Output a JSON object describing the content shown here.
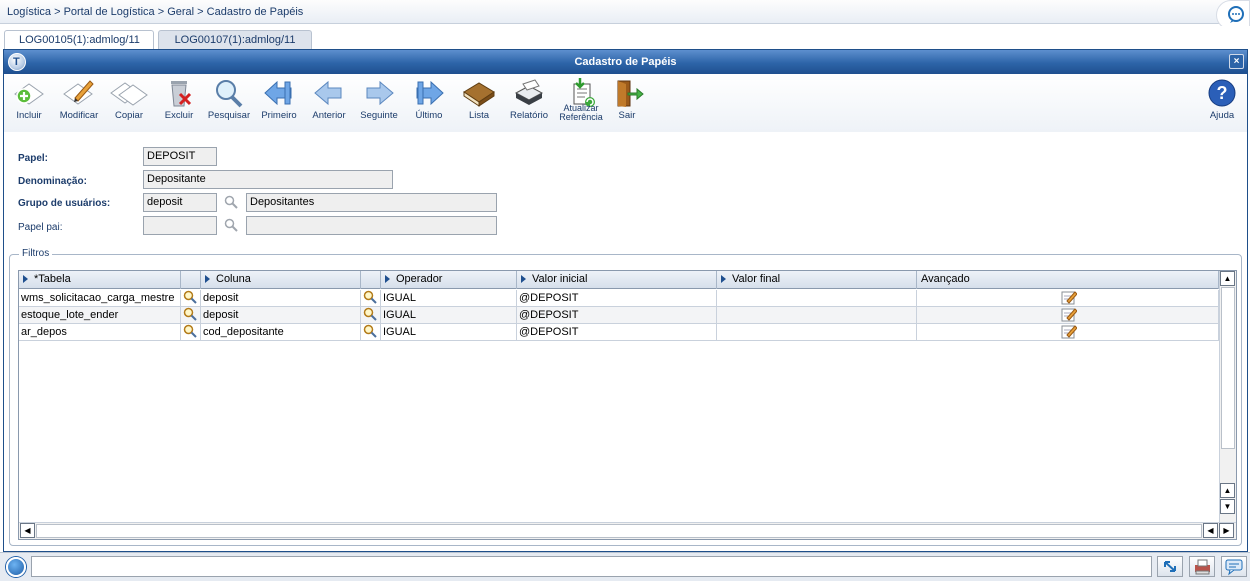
{
  "breadcrumb": "Logística > Portal de Logística > Geral > Cadastro de Papéis",
  "tabs": [
    {
      "label": "LOG00105(1):admlog/11",
      "active": true
    },
    {
      "label": "LOG00107(1):admlog/11",
      "active": false
    }
  ],
  "window": {
    "title": "Cadastro de Papéis",
    "logo_letter": "T",
    "close_label": "×"
  },
  "toolbar": {
    "incluir": "Incluir",
    "modificar": "Modificar",
    "copiar": "Copiar",
    "excluir": "Excluir",
    "pesquisar": "Pesquisar",
    "primeiro": "Primeiro",
    "anterior": "Anterior",
    "seguinte": "Seguinte",
    "ultimo": "Último",
    "lista": "Lista",
    "relatorio": "Relatório",
    "atualizar_1": "Atualizar",
    "atualizar_2": "Referência",
    "sair": "Sair",
    "ajuda": "Ajuda"
  },
  "form": {
    "papel_label": "Papel:",
    "papel_value": "DEPOSIT",
    "denominacao_label": "Denominação:",
    "denominacao_value": "Depositante",
    "grupo_label": "Grupo de usuários:",
    "grupo_code": "deposit",
    "grupo_desc": "Depositantes",
    "papel_pai_label": "Papel pai:",
    "papel_pai_code": "",
    "papel_pai_desc": ""
  },
  "filtros": {
    "legend": "Filtros",
    "columns": {
      "tabela": "*Tabela",
      "coluna": "Coluna",
      "operador": "Operador",
      "valor_inicial": "Valor inicial",
      "valor_final": "Valor final",
      "avancado": "Avançado"
    },
    "rows": [
      {
        "tabela": "wms_solicitacao_carga_mestre",
        "coluna": "deposit",
        "operador": "IGUAL",
        "valor_inicial": "@DEPOSIT",
        "valor_final": ""
      },
      {
        "tabela": "estoque_lote_ender",
        "coluna": "deposit",
        "operador": "IGUAL",
        "valor_inicial": "@DEPOSIT",
        "valor_final": ""
      },
      {
        "tabela": "ar_depos",
        "coluna": "cod_depositante",
        "operador": "IGUAL",
        "valor_inicial": "@DEPOSIT",
        "valor_final": ""
      }
    ]
  },
  "colors": {
    "title_bar": "#2d64a8",
    "label_text": "#1c3c6b",
    "arrow_blue": "#4d8ed8"
  }
}
